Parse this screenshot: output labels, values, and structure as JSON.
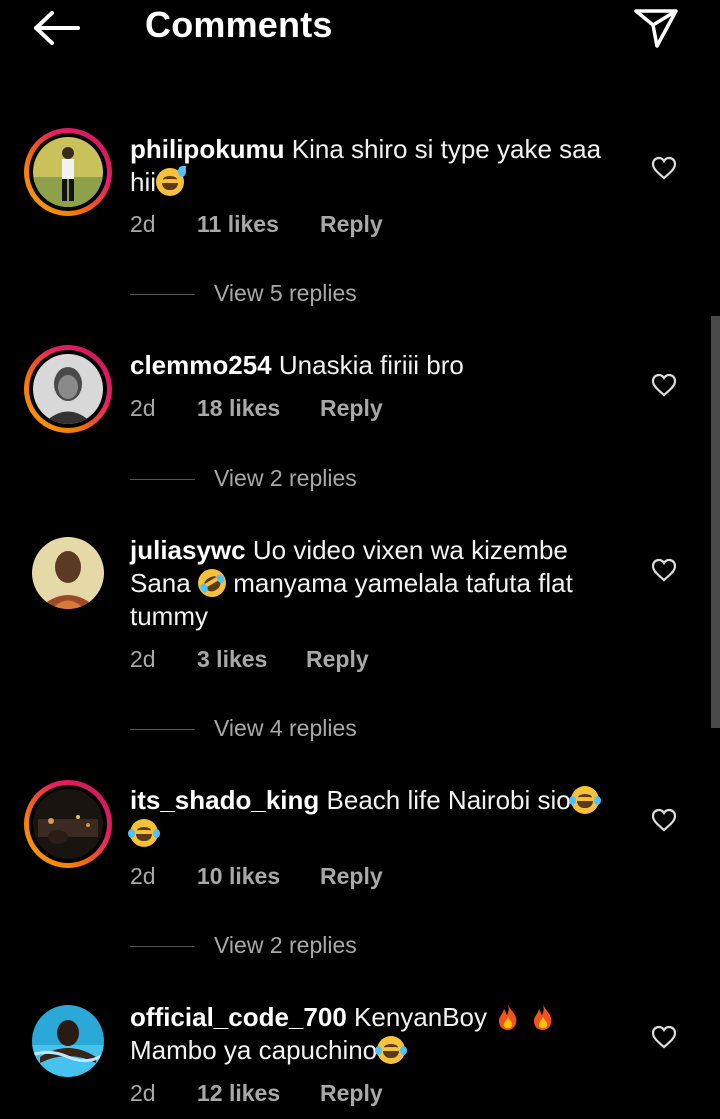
{
  "header": {
    "title": "Comments",
    "back_icon": "arrow-left-icon",
    "share_icon": "paper-plane-icon"
  },
  "colors": {
    "background": "#000000",
    "text": "#f5f5f5",
    "muted": "#a8a8a8",
    "story_ring_start": "#f9a825",
    "story_ring_end": "#c2185b"
  },
  "comments": [
    {
      "username": "philipokumu",
      "text_part1": "Kina shiro si type yake saa hii",
      "text_part2": "",
      "time": "2d",
      "likes": "11 likes",
      "reply": "Reply",
      "view_replies": "View 5 replies",
      "has_story": true
    },
    {
      "username": "clemmo254",
      "text_part1": "Unaskia firiii bro",
      "text_part2": "",
      "time": "2d",
      "likes": "18 likes",
      "reply": "Reply",
      "view_replies": "View 2 replies",
      "has_story": true
    },
    {
      "username": "juliasywc",
      "text_part1": "Uo video vixen wa kizembe Sana",
      "text_part2": "manyama yamelala tafuta flat tummy",
      "time": "2d",
      "likes": "3 likes",
      "reply": "Reply",
      "view_replies": "View 4 replies",
      "has_story": false
    },
    {
      "username": "its_shado_king",
      "text_part1": "Beach life Nairobi sio",
      "text_part2": "",
      "time": "2d",
      "likes": "10 likes",
      "reply": "Reply",
      "view_replies": "View 2 replies",
      "has_story": true
    },
    {
      "username": "official_code_700",
      "text_part1": "KenyanBoy",
      "text_part2": "Mambo ya capuchino",
      "time": "2d",
      "likes": "12 likes",
      "reply": "Reply",
      "has_story": false
    }
  ]
}
